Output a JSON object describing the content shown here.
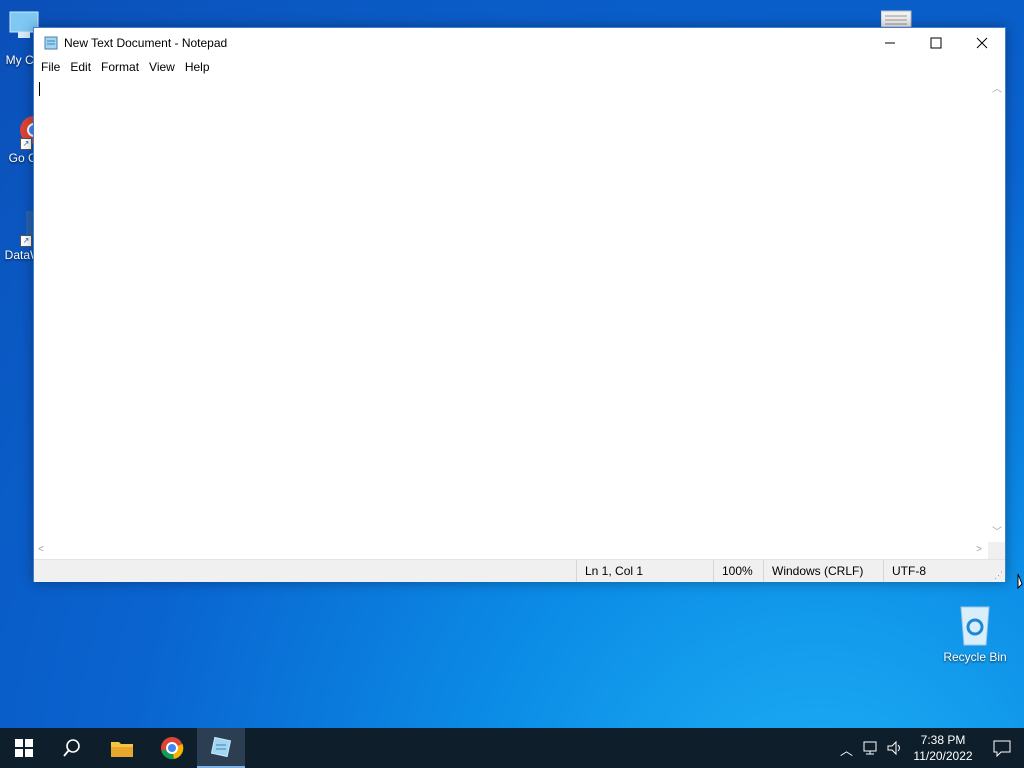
{
  "desktop": {
    "icons": [
      {
        "label": "My Co"
      },
      {
        "label": "Go Ch"
      },
      {
        "label": "DataW"
      },
      {
        "label": "Recycle Bin"
      }
    ]
  },
  "window": {
    "title": "New Text Document - Notepad",
    "menu": [
      "File",
      "Edit",
      "Format",
      "View",
      "Help"
    ],
    "content": "",
    "status": {
      "position": "Ln 1, Col 1",
      "zoom": "100%",
      "line_ending": "Windows (CRLF)",
      "encoding": "UTF-8"
    }
  },
  "taskbar": {
    "time": "7:38 PM",
    "date": "11/20/2022"
  },
  "colors": {
    "taskbar": "#0f1e2b",
    "window_border": "#3f7fcf"
  }
}
